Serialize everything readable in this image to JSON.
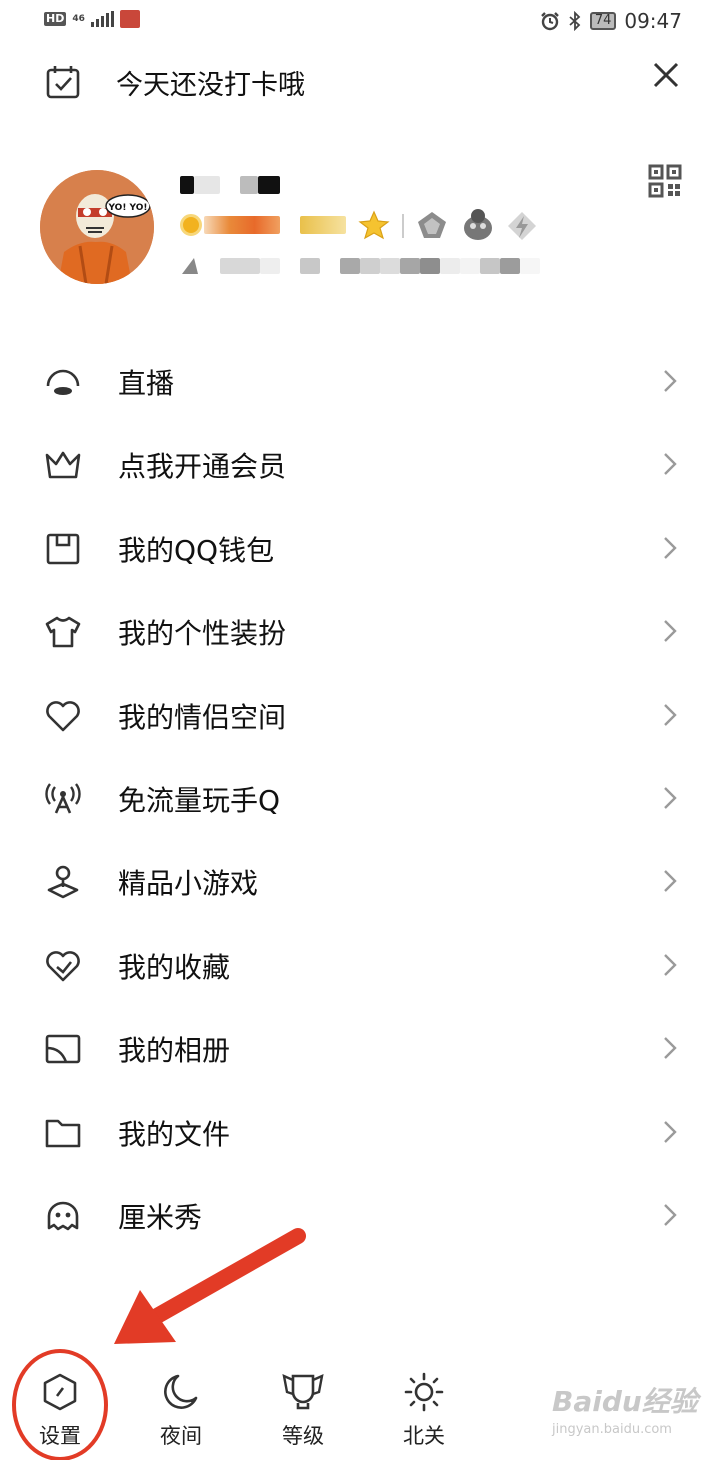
{
  "status_bar": {
    "hd": "HD",
    "network": "46",
    "battery": "74",
    "time": "09:47",
    "icons": [
      "alarm-icon",
      "bluetooth-icon",
      "battery-icon"
    ]
  },
  "checkin": {
    "text": "今天还没打卡哦",
    "icon": "calendar-check-icon",
    "close_icon": "close-icon"
  },
  "profile": {
    "avatar_speech": "YO! YO!",
    "qr_icon": "qr-code-icon"
  },
  "menu": [
    {
      "label": "直播",
      "icon": "live-icon"
    },
    {
      "label": "点我开通会员",
      "icon": "crown-icon"
    },
    {
      "label": "我的QQ钱包",
      "icon": "wallet-icon"
    },
    {
      "label": "我的个性装扮",
      "icon": "tshirt-icon"
    },
    {
      "label": "我的情侣空间",
      "icon": "heart-icon"
    },
    {
      "label": "免流量玩手Q",
      "icon": "signal-tower-icon"
    },
    {
      "label": "精品小游戏",
      "icon": "joystick-icon"
    },
    {
      "label": "我的收藏",
      "icon": "favorite-heart-icon"
    },
    {
      "label": "我的相册",
      "icon": "album-icon"
    },
    {
      "label": "我的文件",
      "icon": "folder-icon"
    },
    {
      "label": "厘米秀",
      "icon": "cmshow-icon"
    }
  ],
  "tabs": [
    {
      "label": "设置",
      "icon": "settings-hexagon-icon"
    },
    {
      "label": "夜间",
      "icon": "moon-icon"
    },
    {
      "label": "等级",
      "icon": "trophy-icon"
    },
    {
      "label": "北关",
      "icon": "sun-icon"
    }
  ],
  "annotation": {
    "color": "#e23b26"
  },
  "watermark": {
    "main": "Baidu经验",
    "sub": "jingyan.baidu.com"
  }
}
